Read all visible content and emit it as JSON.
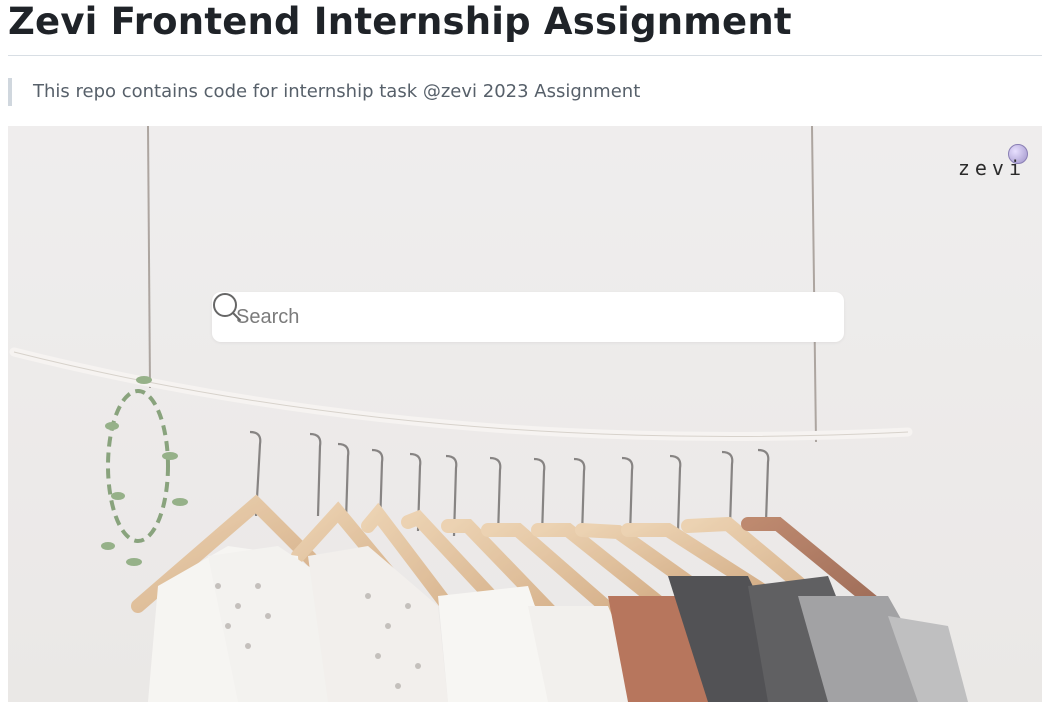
{
  "readme": {
    "title": "Zevi Frontend Internship Assignment",
    "description": "This repo contains code for internship task @zevi 2023 Assignment"
  },
  "hero": {
    "logo_text": "zevi",
    "search": {
      "placeholder": "Search",
      "value": "",
      "icon": "search-icon"
    },
    "photo_subject": "clothes-rack-image"
  },
  "colors": {
    "text": "#1f2328",
    "quote_text": "#57606a",
    "quote_border": "#d0d7de",
    "hero_bg": "#eeecec"
  }
}
